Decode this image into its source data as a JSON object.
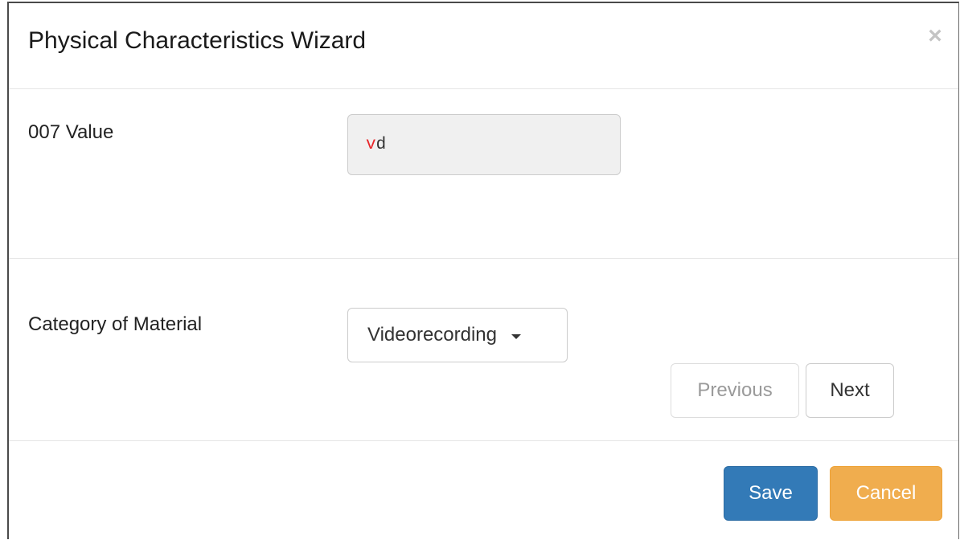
{
  "dialog": {
    "title": "Physical Characteristics Wizard",
    "close_glyph": "×"
  },
  "fields": {
    "value_label": "007 Value",
    "value_first_char": "v",
    "value_rest": "d",
    "category_label": "Category of Material",
    "category_selected": "Videorecording"
  },
  "nav": {
    "previous_label": "Previous",
    "next_label": "Next"
  },
  "footer": {
    "save_label": "Save",
    "cancel_label": "Cancel"
  },
  "colors": {
    "primary": "#337ab7",
    "warning": "#f0ad4e",
    "highlight_char": "#e8262a"
  },
  "icons": {
    "close": "close-icon",
    "caret": "caret-down-icon"
  }
}
